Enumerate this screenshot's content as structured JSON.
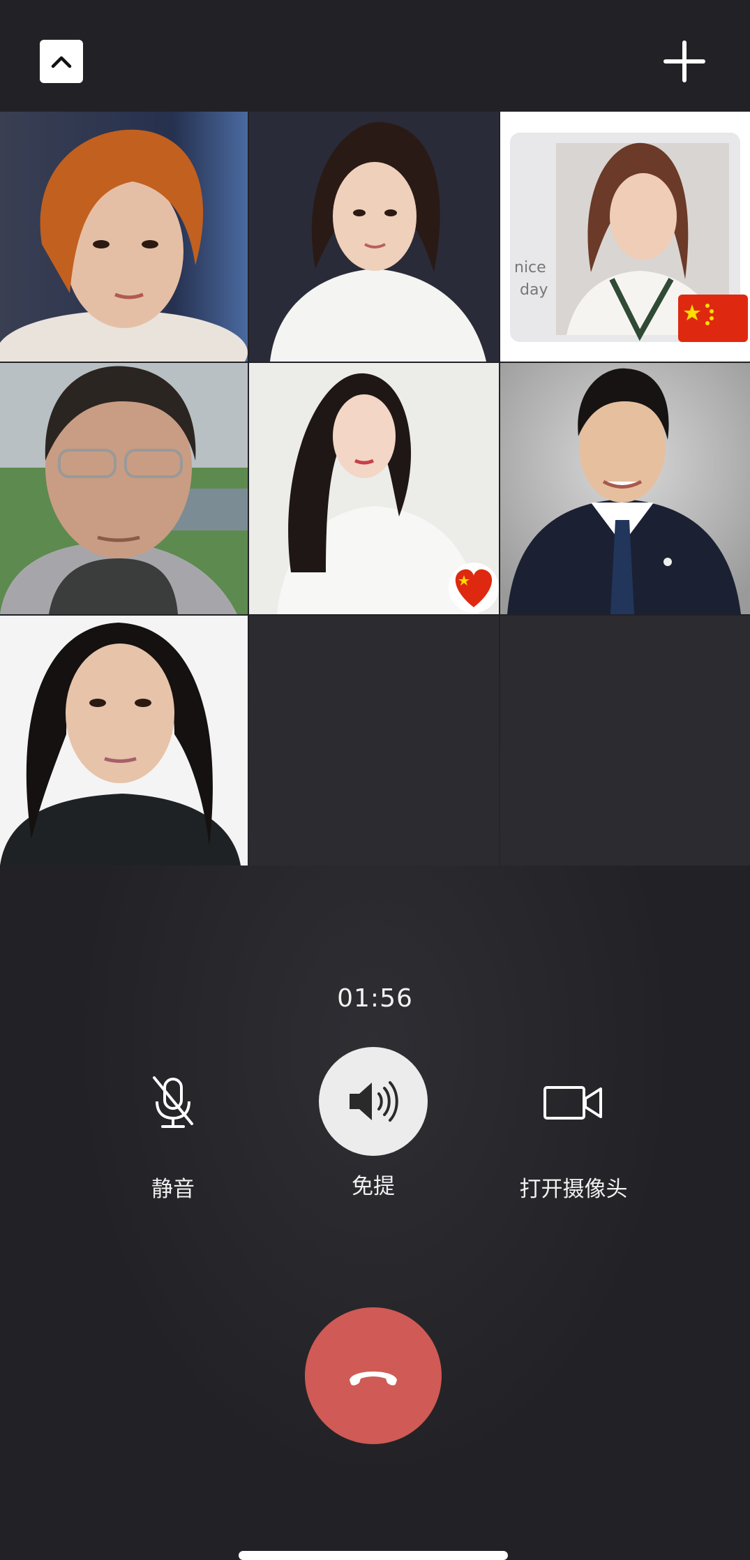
{
  "header": {
    "collapse_icon": "chevron-up-icon",
    "add_icon": "plus-icon"
  },
  "participants": [
    {
      "id": 1,
      "kind": "video"
    },
    {
      "id": 2,
      "kind": "video"
    },
    {
      "id": 3,
      "kind": "video",
      "badge_icon": "china-flag-icon"
    },
    {
      "id": 4,
      "kind": "video"
    },
    {
      "id": 5,
      "kind": "video",
      "badge_icon": "china-flag-heart-icon"
    },
    {
      "id": 6,
      "kind": "video"
    },
    {
      "id": 7,
      "kind": "video"
    },
    {
      "id": 8,
      "kind": "empty"
    },
    {
      "id": 9,
      "kind": "empty"
    }
  ],
  "call": {
    "timer": "01:56"
  },
  "controls": {
    "mute_label": "静音",
    "speaker_label": "免提",
    "camera_label": "打开摄像头",
    "mute_icon": "microphone-muted-icon",
    "speaker_icon": "speaker-icon",
    "camera_icon": "video-camera-icon",
    "hangup_icon": "phone-hangup-icon"
  },
  "colors": {
    "background": "#222226",
    "hangup": "#d05a55",
    "speaker_active": "#ececec"
  }
}
